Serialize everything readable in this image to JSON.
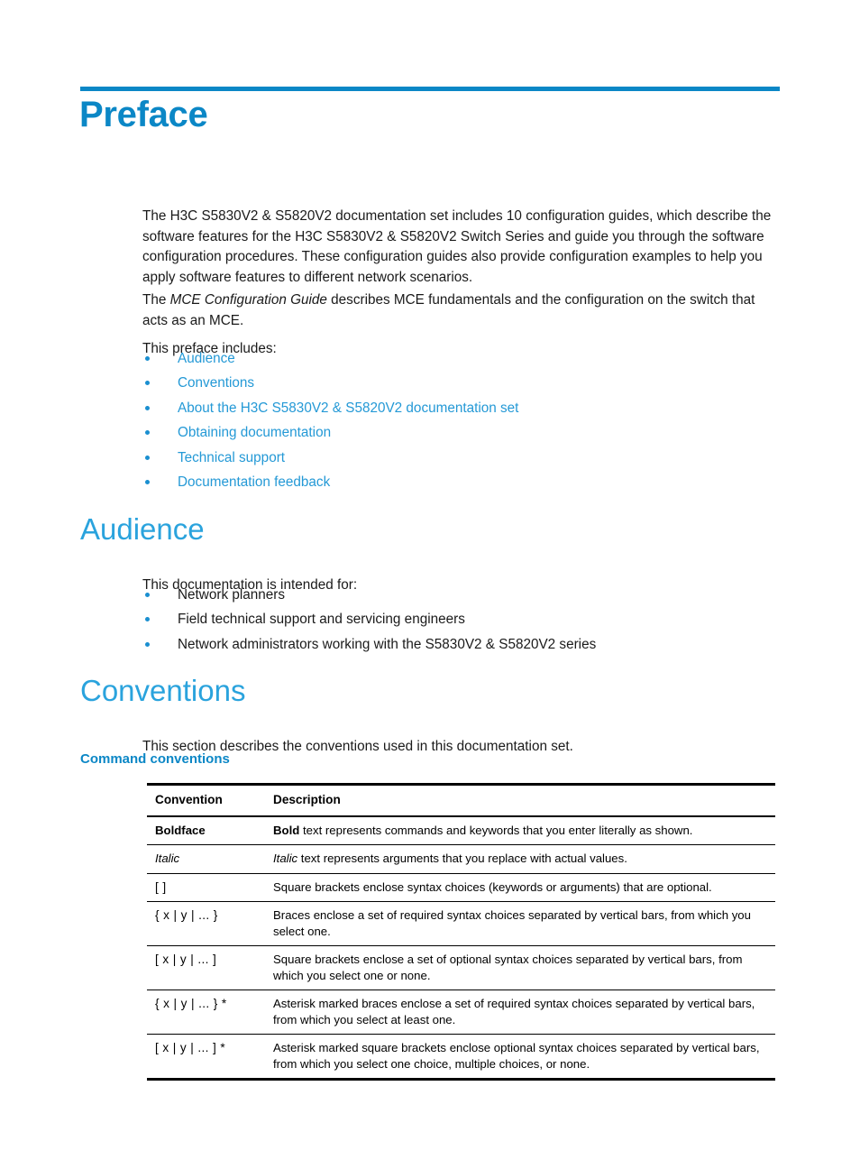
{
  "document": {
    "title": "Preface",
    "accent_color": "#0b87c6",
    "heading_color": "#2aa3dd",
    "link_color": "#2499d6",
    "bullet_color": "#1a8fd0"
  },
  "preface": {
    "heading": "Preface",
    "intro_paragraph_part1": "The H3C S5830V2 & S5820V2 documentation set includes 10 configuration guides, which describe the software features for the H3C S5830V2 & S5820V2 Switch Series and guide you through the software configuration procedures. These configuration guides also provide configuration examples to help you apply software features to different network scenarios.",
    "mce_paragraph_prefix": "The ",
    "mce_paragraph_italic": "MCE Configuration Guide",
    "mce_paragraph_suffix": " describes MCE fundamentals and the configuration on the switch that acts as an MCE.",
    "includes_label": "This preface includes:",
    "links": [
      {
        "label": "Audience"
      },
      {
        "label": "Conventions"
      },
      {
        "label": "About the H3C S5830V2 & S5820V2 documentation set"
      },
      {
        "label": "Obtaining documentation"
      },
      {
        "label": "Technical support"
      },
      {
        "label": "Documentation feedback"
      }
    ]
  },
  "audience": {
    "heading": "Audience",
    "intro": "This documentation is intended for:",
    "items": [
      {
        "label": "Network planners"
      },
      {
        "label": "Field technical support and servicing engineers"
      },
      {
        "label": "Network administrators working with the S5830V2 & S5820V2 series"
      }
    ]
  },
  "conventions": {
    "heading": "Conventions",
    "intro": "This section describes the conventions used in this documentation set.",
    "subheading": "Command conventions",
    "table": {
      "columns": [
        "Convention",
        "Description"
      ],
      "rows": [
        {
          "convention": "Boldface",
          "convention_style": "bold",
          "desc_lead": "Bold",
          "desc_lead_style": "bold",
          "desc_rest": " text represents commands and keywords that you enter literally as shown."
        },
        {
          "convention": "Italic",
          "convention_style": "italic",
          "desc_lead": "Italic",
          "desc_lead_style": "italic",
          "desc_rest": " text represents arguments that you replace with actual values."
        },
        {
          "convention": "[ ]",
          "convention_style": "syntax",
          "desc_lead": "",
          "desc_lead_style": "none",
          "desc_rest": "Square brackets enclose syntax choices (keywords or arguments) that are optional."
        },
        {
          "convention": "{ x | y | ... }",
          "convention_style": "syntax",
          "desc_lead": "",
          "desc_lead_style": "none",
          "desc_rest": "Braces enclose a set of required syntax choices separated by vertical bars, from which you select one."
        },
        {
          "convention": "[ x | y | ... ]",
          "convention_style": "syntax",
          "desc_lead": "",
          "desc_lead_style": "none",
          "desc_rest": "Square brackets enclose a set of optional syntax choices separated by vertical bars, from which you select one or none."
        },
        {
          "convention": "{ x | y | ... } *",
          "convention_style": "syntax",
          "desc_lead": "",
          "desc_lead_style": "none",
          "desc_rest": "Asterisk marked braces enclose a set of required syntax choices separated by vertical bars, from which you select at least one."
        },
        {
          "convention": "[ x | y | ... ] *",
          "convention_style": "syntax",
          "desc_lead": "",
          "desc_lead_style": "none",
          "desc_rest": "Asterisk marked square brackets enclose optional syntax choices separated by vertical bars, from which you select one choice, multiple choices, or none."
        }
      ]
    }
  }
}
